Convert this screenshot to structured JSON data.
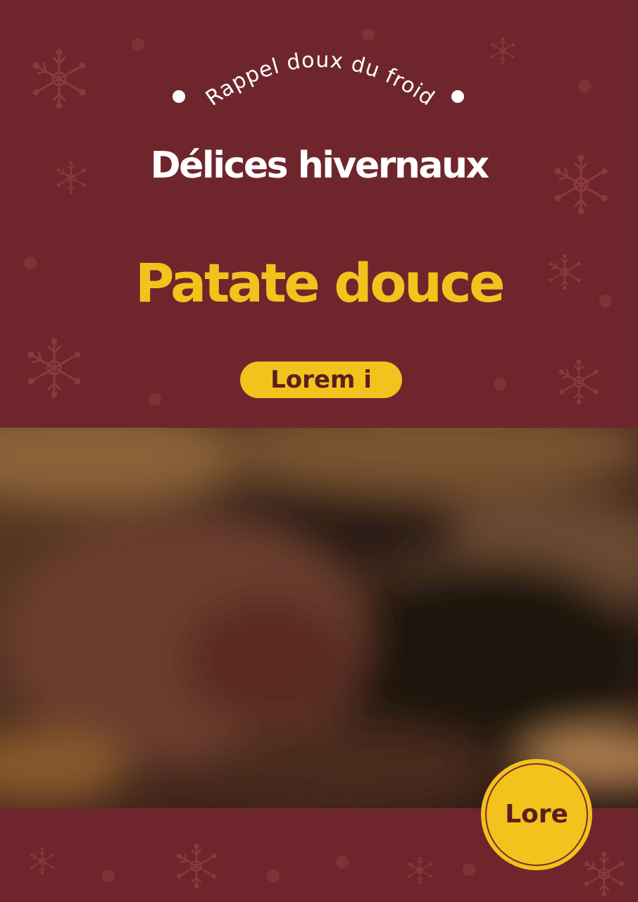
{
  "poster": {
    "arc_text": "Rappel doux du froid",
    "subtitle": "Délices hivernaux",
    "title": "Patate douce",
    "pill_label": "Lorem i",
    "badge_label": "Lore"
  },
  "colors": {
    "background": "#6e262c",
    "accent": "#f2c21d",
    "text_light": "#ffffff",
    "text_dark": "#5b1e1e"
  },
  "icons": [
    "snowflake-icon",
    "bullet-dot-icon"
  ]
}
